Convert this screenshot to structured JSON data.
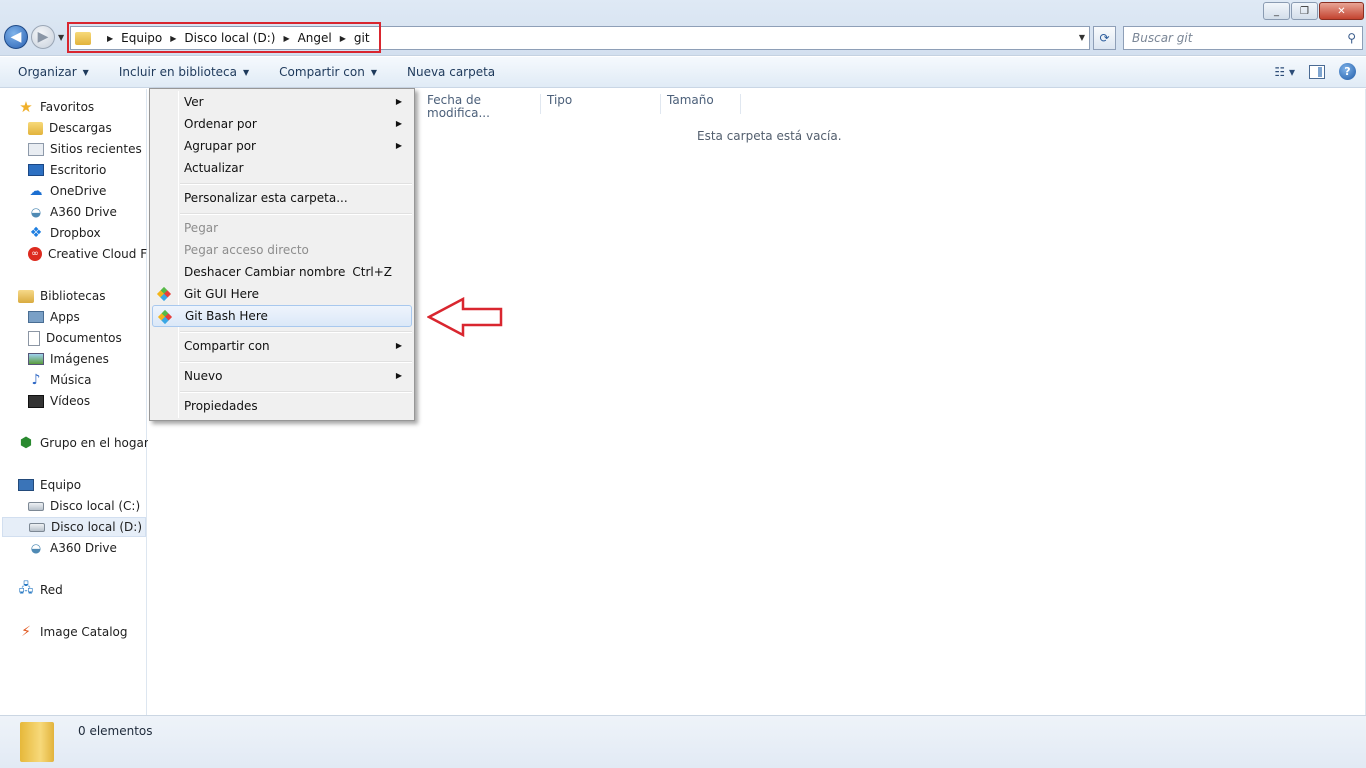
{
  "window": {
    "controls": [
      "_",
      "❐",
      "✕"
    ]
  },
  "address": {
    "breadcrumbs": [
      "Equipo",
      "Disco local (D:)",
      "Angel",
      "git"
    ],
    "search_placeholder": "Buscar git"
  },
  "toolbar": {
    "organize": "Organizar",
    "include_library": "Incluir en biblioteca",
    "share_with": "Compartir con",
    "new_folder": "Nueva carpeta"
  },
  "sidebar": {
    "favorites": {
      "title": "Favoritos",
      "items": [
        "Descargas",
        "Sitios recientes",
        "Escritorio",
        "OneDrive",
        "A360 Drive",
        "Dropbox",
        "Creative Cloud Files"
      ]
    },
    "libraries": {
      "title": "Bibliotecas",
      "items": [
        "Apps",
        "Documentos",
        "Imágenes",
        "Música",
        "Vídeos"
      ]
    },
    "homegroup": "Grupo en el hogar",
    "computer": {
      "title": "Equipo",
      "items": [
        "Disco local (C:)",
        "Disco local (D:)",
        "A360 Drive"
      ]
    },
    "network": "Red",
    "image_catalog": "Image Catalog"
  },
  "columns": [
    "Fecha de modifica...",
    "Tipo",
    "Tamaño"
  ],
  "empty_message": "Esta carpeta está vacía.",
  "context_menu": {
    "items": [
      {
        "label": "Ver"
      },
      {
        "label": "Ordenar por"
      },
      {
        "label": "Agrupar por"
      },
      {
        "label": "Actualizar"
      },
      {
        "label": "Personalizar esta carpeta..."
      },
      {
        "label": "Pegar"
      },
      {
        "label": "Pegar acceso directo"
      },
      {
        "label": "Deshacer Cambiar nombre",
        "shortcut": "Ctrl+Z"
      },
      {
        "label": "Git GUI Here"
      },
      {
        "label": "Git Bash Here"
      },
      {
        "label": "Compartir con"
      },
      {
        "label": "Nuevo"
      },
      {
        "label": "Propiedades"
      }
    ]
  },
  "status": {
    "count": "0 elementos"
  },
  "colors": {
    "highlight_red": "#d9262f",
    "toolbar_text": "#1e395b"
  }
}
